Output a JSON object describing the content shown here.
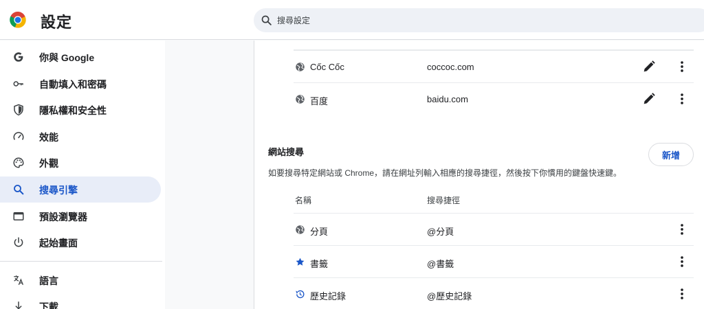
{
  "header": {
    "title": "設定",
    "logo_icon": "chrome-logo",
    "search_placeholder": "搜尋設定"
  },
  "sidebar": {
    "items": [
      {
        "label": "你與 Google",
        "icon": "google-g-icon"
      },
      {
        "label": "自動填入和密碼",
        "icon": "key-icon"
      },
      {
        "label": "隱私權和安全性",
        "icon": "shield-icon"
      },
      {
        "label": "效能",
        "icon": "speedometer-icon"
      },
      {
        "label": "外觀",
        "icon": "palette-icon"
      },
      {
        "label": "搜尋引擎",
        "icon": "search-icon",
        "active": true
      },
      {
        "label": "預設瀏覽器",
        "icon": "browser-window-icon"
      },
      {
        "label": "起始畫面",
        "icon": "power-icon"
      },
      {
        "label": "語言",
        "icon": "translate-icon"
      },
      {
        "label": "下載",
        "icon": "download-icon"
      }
    ]
  },
  "search_engines": [
    {
      "name": "Cốc Cốc",
      "keyword": "coccoc.com",
      "icon": "globe-icon"
    },
    {
      "name": "百度",
      "keyword": "baidu.com",
      "icon": "globe-icon"
    }
  ],
  "site_search": {
    "title": "網站搜尋",
    "description": "如要搜尋特定網站或 Chrome，請在網址列輸入相應的搜尋捷徑，然後按下你慣用的鍵盤快速鍵。",
    "add_label": "新增",
    "columns": {
      "name": "名稱",
      "shortcut": "搜尋捷徑"
    },
    "rows": [
      {
        "name": "分頁",
        "shortcut": "@分頁",
        "icon": "globe-icon"
      },
      {
        "name": "書籤",
        "shortcut": "@書籤",
        "icon": "star-icon"
      },
      {
        "name": "歷史記錄",
        "shortcut": "@歷史記錄",
        "icon": "history-icon"
      }
    ]
  },
  "colors": {
    "accent": "#1a56c8",
    "active_bg": "#e8edf8",
    "divider": "#dadce0"
  }
}
